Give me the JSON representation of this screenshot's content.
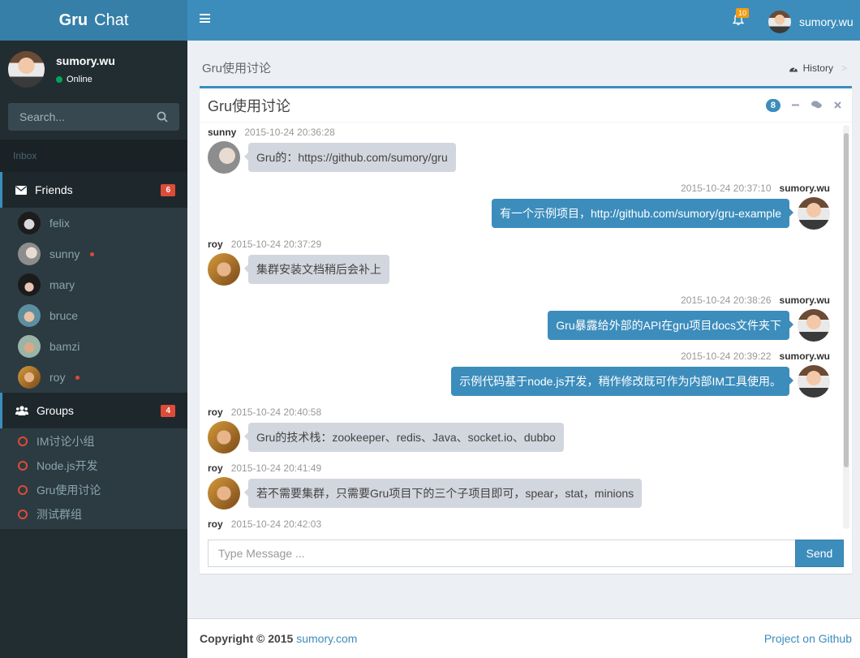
{
  "app": {
    "logo_bold": "Gru",
    "logo_light": "Chat"
  },
  "user": {
    "name": "sumory.wu",
    "status": "Online"
  },
  "search": {
    "placeholder": "Search..."
  },
  "sidebar": {
    "inbox_label": "Inbox",
    "friends": {
      "label": "Friends",
      "badge": "6",
      "items": [
        {
          "name": "felix",
          "unread": false
        },
        {
          "name": "sunny",
          "unread": true
        },
        {
          "name": "mary",
          "unread": false
        },
        {
          "name": "bruce",
          "unread": false
        },
        {
          "name": "bamzi",
          "unread": false
        },
        {
          "name": "roy",
          "unread": true
        }
      ]
    },
    "groups": {
      "label": "Groups",
      "badge": "4",
      "items": [
        "IM讨论小组",
        "Node.js开发",
        "Gru使用讨论",
        "测试群组"
      ]
    }
  },
  "topbar": {
    "notification_count": "10",
    "user_name": "sumory.wu"
  },
  "page": {
    "title": "Gru使用讨论",
    "history_label": "History",
    "history_sep": ">"
  },
  "chat": {
    "title": "Gru使用讨论",
    "message_count": "8",
    "messages": [
      {
        "sender": "sunny",
        "time": "2015-10-24 20:36:28",
        "text": "Gru的：https://github.com/sumory/gru",
        "side": "left"
      },
      {
        "sender": "sumory.wu",
        "time": "2015-10-24 20:37:10",
        "text": "有一个示例项目，http://github.com/sumory/gru-example",
        "side": "right"
      },
      {
        "sender": "roy",
        "time": "2015-10-24 20:37:29",
        "text": "集群安装文档稍后会补上",
        "side": "left"
      },
      {
        "sender": "sumory.wu",
        "time": "2015-10-24 20:38:26",
        "text": "Gru暴露给外部的API在gru项目docs文件夹下",
        "side": "right"
      },
      {
        "sender": "sumory.wu",
        "time": "2015-10-24 20:39:22",
        "text": "示例代码基于node.js开发，稍作修改既可作为内部IM工具使用。",
        "side": "right"
      },
      {
        "sender": "roy",
        "time": "2015-10-24 20:40:58",
        "text": "Gru的技术栈：zookeeper、redis、Java、socket.io、dubbo",
        "side": "left"
      },
      {
        "sender": "roy",
        "time": "2015-10-24 20:41:49",
        "text": "若不需要集群，只需要Gru项目下的三个子项目即可，spear，stat，minions",
        "side": "left"
      },
      {
        "sender": "roy",
        "time": "2015-10-24 20:42:03",
        "text": "",
        "side": "left"
      }
    ],
    "input_placeholder": "Type Message ...",
    "send_label": "Send"
  },
  "footer": {
    "copyright": "Copyright © 2015",
    "brand": "sumory.com",
    "github_link": "Project on Github"
  },
  "colors": {
    "primary": "#3c8dbc",
    "header_dark": "#367fa9",
    "sidebar": "#222d32",
    "danger": "#dd4b39",
    "warning": "#f39c12",
    "success": "#00a65a"
  }
}
